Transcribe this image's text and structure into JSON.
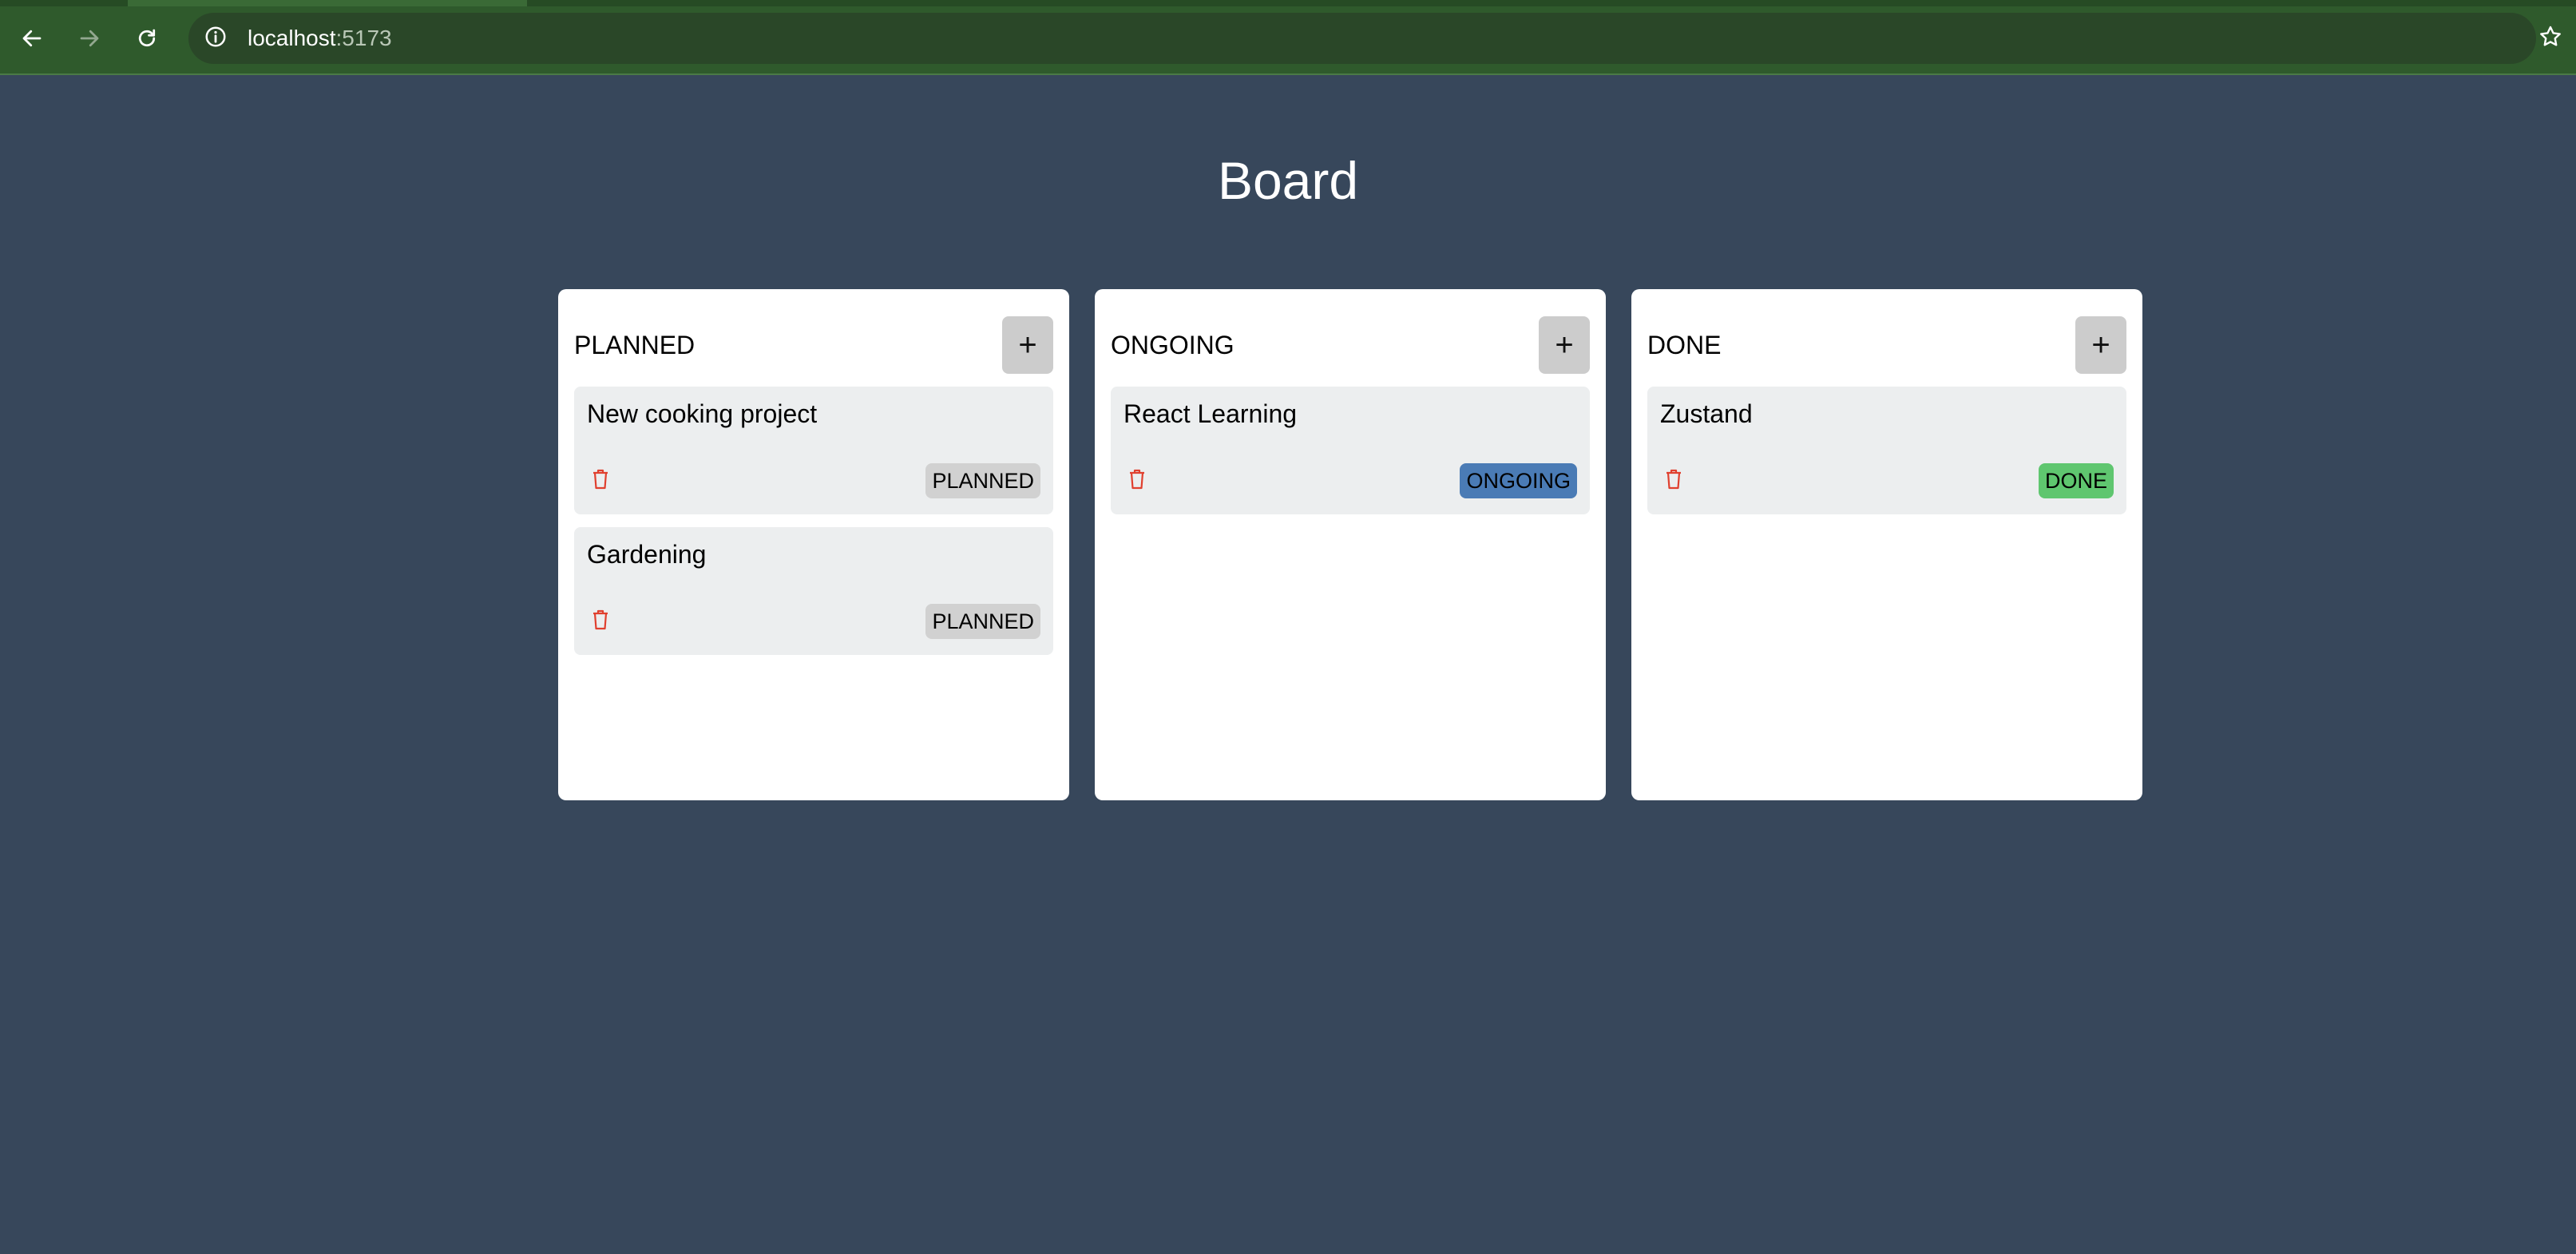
{
  "browser": {
    "url_host": "localhost",
    "url_port": ":5173",
    "icons": {
      "back": "arrow-left-icon",
      "forward": "arrow-right-icon",
      "reload": "reload-icon",
      "site_info": "info-icon",
      "bookmark": "star-icon"
    }
  },
  "page": {
    "title": "Board"
  },
  "columns": [
    {
      "title": "PLANNED",
      "add_label": "+",
      "cards": [
        {
          "title": "New cooking project",
          "status": "PLANNED"
        },
        {
          "title": "Gardening",
          "status": "PLANNED"
        }
      ]
    },
    {
      "title": "ONGOING",
      "add_label": "+",
      "cards": [
        {
          "title": "React Learning",
          "status": "ONGOING"
        }
      ]
    },
    {
      "title": "DONE",
      "add_label": "+",
      "cards": [
        {
          "title": "Zustand",
          "status": "DONE"
        }
      ]
    }
  ],
  "colors": {
    "page_background": "#37475b",
    "chrome_background": "#2f5a2c",
    "column_background": "#ffffff",
    "card_background": "#eceeef",
    "add_button": "#cccccc",
    "badge_planned": "#d1d1d1",
    "badge_ongoing": "#4a7bb5",
    "badge_done": "#5fc66f",
    "trash_icon": "#e0402f"
  }
}
